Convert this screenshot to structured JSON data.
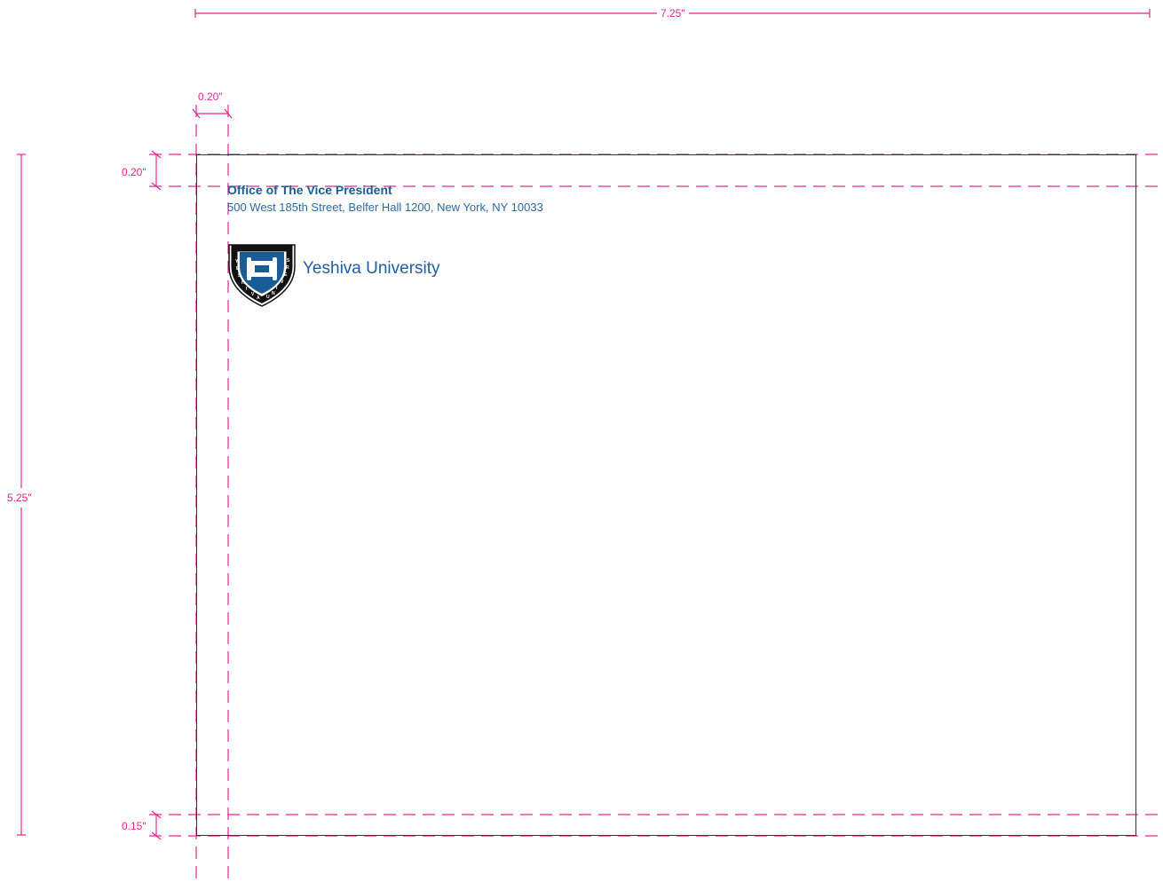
{
  "dimensions": {
    "width": "7.25\"",
    "height": "5.25\"",
    "left_margin": "0.20\"",
    "top_margin": "0.20\"",
    "bottom_margin": "0.15\""
  },
  "letterhead": {
    "office": "Office of The Vice President",
    "address": "500 West 185th Street, Belfer Hall 1200, New York, NY 10033",
    "university": "Yeshiva University",
    "seal_arc_text": "YESHIVA UNIVERSITY"
  },
  "colors": {
    "guide": "#e0288f",
    "brand_blue": "#1a5c96",
    "border": "#333333"
  },
  "icons": {
    "seal": "university-seal-icon"
  }
}
